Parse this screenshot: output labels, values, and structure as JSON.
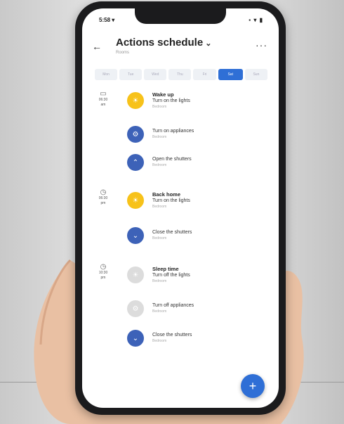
{
  "status": {
    "time": "5:58 ▾",
    "icons": "▪ ▾ ▮"
  },
  "header": {
    "title": "Actions schedule",
    "subtitle": "Rooms",
    "more": "···"
  },
  "tabs": [
    "Mon",
    "Tue",
    "Wed",
    "Thu",
    "Fri",
    "Sat",
    "Sun"
  ],
  "active_tab": 5,
  "groups": [
    {
      "time": "06:30",
      "ampm": "am"
    },
    {
      "time": "06:30",
      "ampm": "pm"
    },
    {
      "time": "10:30",
      "ampm": "pm"
    }
  ],
  "items": [
    {
      "group": "Wake up",
      "action": "Turn on the lights",
      "room": "Bedroom",
      "color": "yellow"
    },
    {
      "group": "",
      "action": "Turn on appliances",
      "room": "Bedroom",
      "color": "blue"
    },
    {
      "group": "",
      "action": "Open the shutters",
      "room": "Bedroom",
      "color": "blue"
    },
    {
      "group": "Back home",
      "action": "Turn on the lights",
      "room": "Bedroom",
      "color": "yellow"
    },
    {
      "group": "",
      "action": "Close the shutters",
      "room": "Bedroom",
      "color": "blue"
    },
    {
      "group": "Sleep time",
      "action": "Turn off the lights",
      "room": "Bedroom",
      "color": "grey"
    },
    {
      "group": "",
      "action": "Turn off appliances",
      "room": "Bedroom",
      "color": "grey"
    },
    {
      "group": "",
      "action": "Close the shutters",
      "room": "Bedroom",
      "color": "blue"
    }
  ],
  "fab": "+",
  "colors": {
    "accent": "#2f6fd6",
    "yellow": "#f7c21a",
    "blue": "#3d62b8",
    "grey": "#dcdcdc"
  }
}
